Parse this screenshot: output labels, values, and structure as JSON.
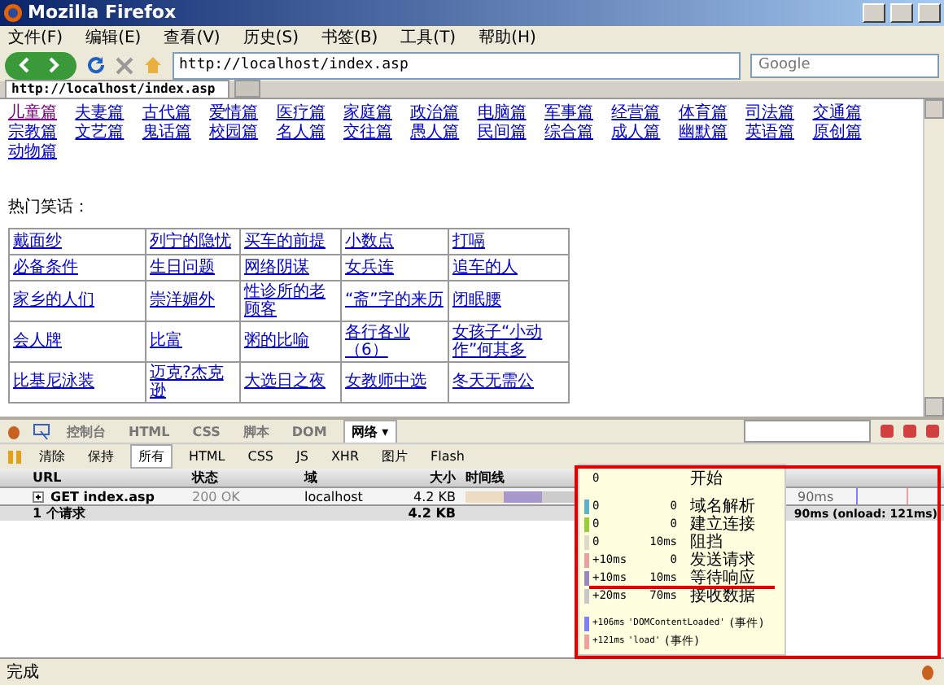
{
  "window": {
    "title": "Mozilla Firefox"
  },
  "menu": [
    "文件(F)",
    "编辑(E)",
    "查看(V)",
    "历史(S)",
    "书签(B)",
    "工具(T)",
    "帮助(H)"
  ],
  "address": {
    "value": "http://localhost/index.asp"
  },
  "search": {
    "placeholder": "Google"
  },
  "tabs": [
    {
      "label": "http://localhost/index.asp",
      "selected": true
    }
  ],
  "categories": [
    {
      "label": "儿童篇",
      "visited": true
    },
    {
      "label": "夫妻篇",
      "visited": false
    },
    {
      "label": "古代篇",
      "visited": false
    },
    {
      "label": "爱情篇",
      "visited": false
    },
    {
      "label": "医疗篇",
      "visited": false
    },
    {
      "label": "家庭篇",
      "visited": false
    },
    {
      "label": "政治篇",
      "visited": false
    },
    {
      "label": "电脑篇",
      "visited": false
    },
    {
      "label": "军事篇",
      "visited": false
    },
    {
      "label": "经营篇",
      "visited": false
    },
    {
      "label": "体育篇",
      "visited": false
    },
    {
      "label": "司法篇",
      "visited": false
    },
    {
      "label": "交通篇",
      "visited": false
    },
    {
      "label": "宗教篇",
      "visited": false
    },
    {
      "label": "文艺篇",
      "visited": false
    },
    {
      "label": "鬼话篇",
      "visited": false
    },
    {
      "label": "校园篇",
      "visited": false
    },
    {
      "label": "名人篇",
      "visited": false
    },
    {
      "label": "交往篇",
      "visited": false
    },
    {
      "label": "愚人篇",
      "visited": false
    },
    {
      "label": "民间篇",
      "visited": false
    },
    {
      "label": "综合篇",
      "visited": false
    },
    {
      "label": "成人篇",
      "visited": false
    },
    {
      "label": "幽默篇",
      "visited": false
    },
    {
      "label": "英语篇",
      "visited": false
    },
    {
      "label": "原创篇",
      "visited": false
    },
    {
      "label": "动物篇",
      "visited": false
    }
  ],
  "heading": "热门笑话：",
  "jokes": [
    [
      "戴面纱",
      "列宁的隐忧",
      "买车的前提",
      "小数点",
      "打嗝"
    ],
    [
      "必备条件",
      "生日问题",
      "网络阴谋",
      "女兵连",
      "追车的人"
    ],
    [
      "家乡的人们",
      "崇洋媚外",
      "性诊所的老顾客",
      "“斋”字的来历",
      "闭眠腰"
    ],
    [
      "会人牌",
      "比富",
      "粥的比喻",
      "各行各业（6）",
      "女孩子“小动作”何其多"
    ],
    [
      "比基尼泳装",
      "迈克?杰克逊",
      "大选日之夜",
      "女教师中选",
      "冬天无需公"
    ]
  ],
  "firebug": {
    "tabs": [
      {
        "label": "控制台",
        "selected": false
      },
      {
        "label": "HTML",
        "selected": false
      },
      {
        "label": "CSS",
        "selected": false
      },
      {
        "label": "脚本",
        "selected": false
      },
      {
        "label": "DOM",
        "selected": false
      },
      {
        "label": "网络 ▾",
        "selected": true
      }
    ],
    "actions": [
      "清除",
      "保持"
    ],
    "filters": [
      {
        "label": "所有",
        "selected": true
      },
      {
        "label": "HTML",
        "selected": false
      },
      {
        "label": "CSS",
        "selected": false
      },
      {
        "label": "JS",
        "selected": false
      },
      {
        "label": "XHR",
        "selected": false
      },
      {
        "label": "图片",
        "selected": false
      },
      {
        "label": "Flash",
        "selected": false
      }
    ],
    "columns": [
      "URL",
      "状态",
      "域",
      "大小",
      "时间线"
    ],
    "requests": [
      {
        "url": "GET index.asp",
        "status": "200 OK",
        "domain": "localhost",
        "size": "4.2 KB",
        "time": "90ms"
      }
    ],
    "summary": {
      "count": "1 个请求",
      "size": "4.2 KB",
      "time": "90ms (onload: 121ms)"
    },
    "tooltip": [
      {
        "kind": "start",
        "start": "0",
        "label": "开始"
      },
      {
        "kind": "phase",
        "start": "0",
        "duration": "0",
        "label": "域名解析",
        "color": "#5ab4d0"
      },
      {
        "kind": "phase",
        "start": "0",
        "duration": "0",
        "label": "建立连接",
        "color": "#9acd3a"
      },
      {
        "kind": "phase",
        "start": "0",
        "duration": "10ms",
        "label": "阻挡",
        "color": "#e0d8c8"
      },
      {
        "kind": "phase",
        "start": "+10ms",
        "duration": "0",
        "label": "发送请求",
        "color": "#e8a0a0"
      },
      {
        "kind": "phase",
        "start": "+10ms",
        "duration": "10ms",
        "label": "等待响应",
        "color": "#9a88c0"
      },
      {
        "kind": "phase",
        "start": "+20ms",
        "duration": "70ms",
        "label": "接收数据",
        "color": "#c8c8c8"
      },
      {
        "kind": "event",
        "start": "+106ms",
        "label": "'DOMContentLoaded'",
        "suffix": "(事件)",
        "color": "#8080ff"
      },
      {
        "kind": "event",
        "start": "+121ms",
        "label": "'load'",
        "suffix": "(事件)",
        "color": "#f0a0a0"
      }
    ]
  },
  "status_bar": "完成"
}
